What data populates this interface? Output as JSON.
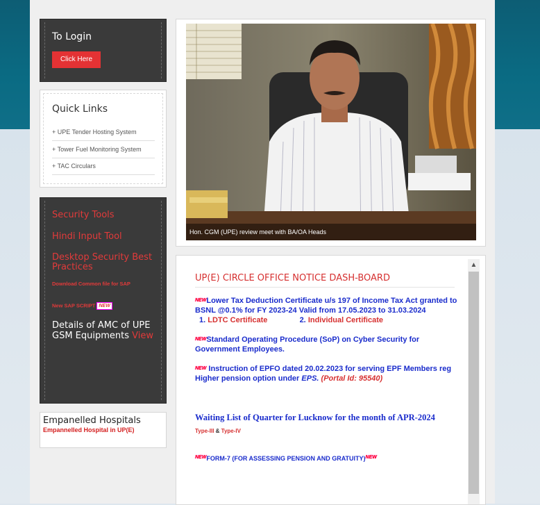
{
  "login": {
    "title": "To Login",
    "button": "Click Here"
  },
  "quick_links": {
    "title": "Quick Links",
    "items": [
      "UPE Tender Hosting System",
      "Tower Fuel Monitoring System",
      "TAC Circulars"
    ]
  },
  "security": {
    "security_tools": "Security Tools",
    "hindi_input": "Hindi Input Tool",
    "desktop_security": "Desktop Security Best Practices",
    "download_sap": "Download Common file for SAP",
    "new_sap": "New SAP SCRIPT",
    "new_badge": "NEW",
    "amc_text": "Details of AMC of UPE GSM Equipments",
    "amc_view": "View"
  },
  "hospitals": {
    "title": "Empanelled Hospitals",
    "link": "Empannelled Hospital in UP(E)"
  },
  "photo": {
    "caption": "Hon. CGM (UPE) review meet with BA/OA Heads"
  },
  "notice": {
    "title": "UP(E) CIRCLE OFFICE NOTICE DASH-BOARD",
    "new_tag": "NEW",
    "item1": "Lower Tax Deduction Certificate u/s 197 of Income Tax Act granted to BSNL @0.1% for FY 2023-24 Valid from 17.05.2023 to 31.03.2024",
    "item1_link1_num": "1.",
    "item1_link1": "LDTC Certificate",
    "item1_link2_num": "2.",
    "item1_link2": "Individual Certificate",
    "item2": "Standard Operating Procedure (SoP) on Cyber Security for Government Employees.",
    "item3_a": "Instruction of EPFO dated 20.02.2023 for serving EPF Members reg Higher pension option under ",
    "item3_eps": "EPS.",
    "item3_portal": "(Portal Id: 95540)",
    "waiting": "Waiting List of Quarter for Lucknow for the month of  APR-2024",
    "type3": "Type-III",
    "amp": "&",
    "type4": "Type-IV",
    "form7": "FORM-7 (FOR ASSESSING PENSION AND GRATUITY)"
  }
}
